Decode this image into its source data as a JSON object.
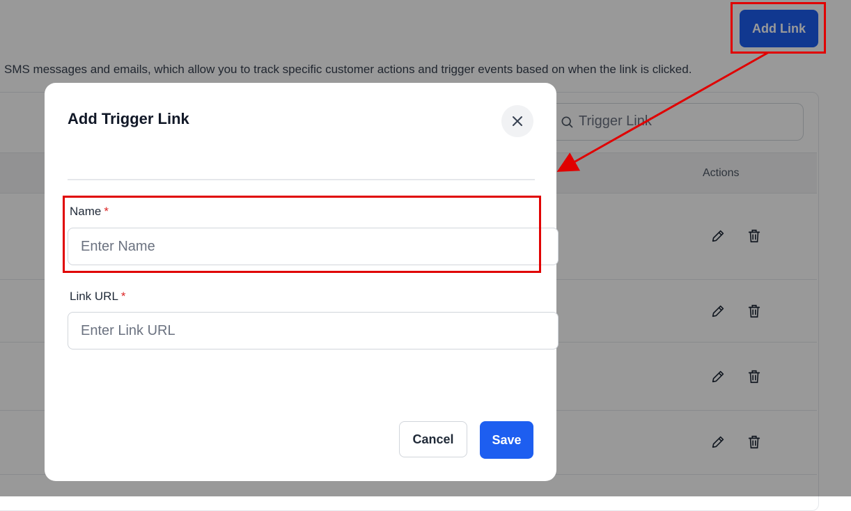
{
  "page": {
    "add_link_label": "Add Link",
    "description": "SMS messages and emails, which allow you to track specific customer actions and trigger events based on when the link is clicked.",
    "search_placeholder": "Trigger Link",
    "actions_header": "Actions",
    "row_count": 4
  },
  "modal": {
    "title": "Add Trigger Link",
    "close_icon": "close-icon",
    "fields": [
      {
        "label": "Name",
        "required_mark": "*",
        "placeholder": "Enter Name",
        "value": ""
      },
      {
        "label": "Link URL",
        "required_mark": "*",
        "placeholder": "Enter Link URL",
        "value": ""
      }
    ],
    "cancel_label": "Cancel",
    "save_label": "Save"
  },
  "colors": {
    "primary": "#1d5ef0",
    "overlay": "rgba(0,0,0,0.40)",
    "annotation": "#e00000",
    "required": "#dc2626"
  },
  "icons": [
    "search-icon",
    "edit-icon",
    "trash-icon",
    "close-icon"
  ]
}
